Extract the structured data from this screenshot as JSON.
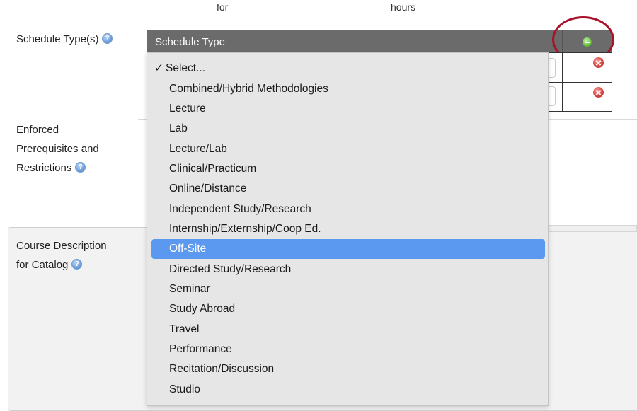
{
  "top_fragments": {
    "left": "for",
    "right": "hours"
  },
  "labels": {
    "schedule_types": "Schedule Type(s)",
    "enforced_line1": "Enforced",
    "enforced_line2": "Prerequisites and",
    "enforced_line3": "Restrictions",
    "desc_line1": "Course Description",
    "desc_line2": "for Catalog"
  },
  "schedule_table": {
    "header": "Schedule Type"
  },
  "dropdown": {
    "check_mark": "✓",
    "options": [
      "Select...",
      "Combined/Hybrid Methodologies",
      "Lecture",
      "Lab",
      "Lecture/Lab",
      "Clinical/Practicum",
      "Online/Distance",
      "Independent Study/Research",
      "Internship/Externship/Coop Ed.",
      "Off-Site",
      "Directed Study/Research",
      "Seminar",
      "Study Abroad",
      "Travel",
      "Performance",
      "Recitation/Discussion",
      "Studio"
    ],
    "selected_option": "Select...",
    "highlighted_option": "Off-Site"
  },
  "icons": {
    "help": "help-icon",
    "add": "add-icon",
    "delete": "delete-icon",
    "check": "checkmark-icon"
  },
  "colors": {
    "header_bg": "#6b6b6b",
    "highlight": "#5b98f0",
    "ring": "#a8122a",
    "add_green": "#64c23a",
    "delete_red": "#d9453f"
  }
}
